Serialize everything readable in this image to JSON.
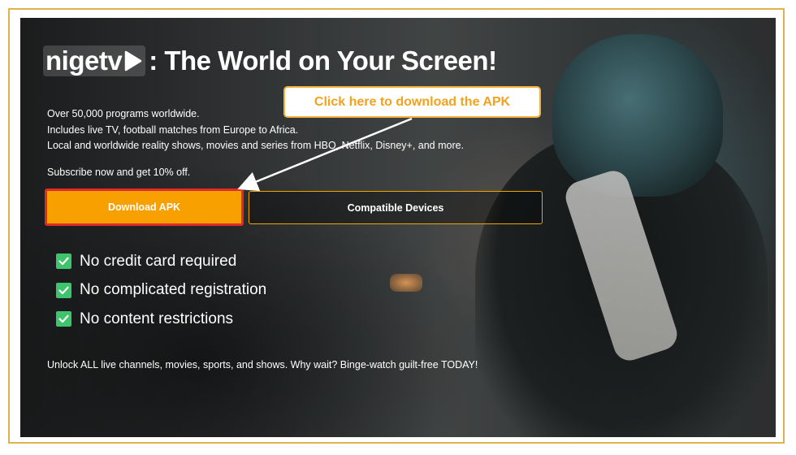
{
  "hero": {
    "logo_text": "nigetv",
    "title_rest": ": The World on Your Screen!",
    "description_lines": [
      "Over 50,000 programs worldwide.",
      "Includes live TV, football matches from Europe to Africa.",
      "Local and worldwide reality shows, movies and series from HBO, Netflix, Disney+, and more."
    ],
    "subscribe_text": "Subscribe now and get 10% off.",
    "download_button": "Download APK",
    "compatible_button": "Compatible Devices",
    "features": [
      "No credit card required",
      "No complicated registration",
      "No content restrictions"
    ],
    "footer_text": "Unlock ALL live channels, movies, sports, and shows. Why wait? Binge-watch guilt-free TODAY!"
  },
  "annotation": {
    "callout_text": "Click here to download the APK"
  },
  "colors": {
    "accent": "#f7a000",
    "highlight_border": "#e02b2b",
    "callout_text": "#f2a21b",
    "frame": "#e0b24a",
    "check": "#3ec46d"
  },
  "icons": {
    "logo_play": "play-icon",
    "feature_check": "checkbox-checked-icon"
  }
}
